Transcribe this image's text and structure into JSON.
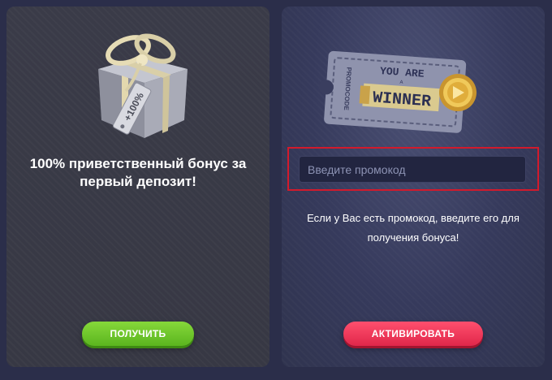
{
  "welcome_bonus": {
    "title": "100% приветственный бонус за первый депозит!",
    "gift_tag_text": "+100%",
    "button_label": "ПОЛУЧИТЬ"
  },
  "promocode": {
    "ticket": {
      "side_text": "PROMOCODE",
      "line1": "YOU ARE",
      "line_small": "A",
      "line2": "WINNER"
    },
    "input_placeholder": "Введите промокод",
    "description": "Если у Вас есть промокод, введите его для получения бонуса!",
    "button_label": "АКТИВИРОВАТЬ"
  },
  "colors": {
    "green_button": "#6cc82a",
    "red_button": "#f03a5c",
    "highlight_frame": "#d21a2c"
  }
}
